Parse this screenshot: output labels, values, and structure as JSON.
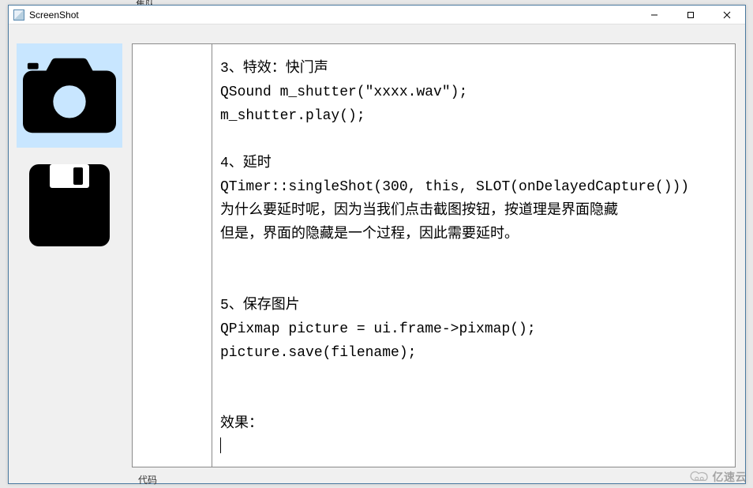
{
  "window": {
    "title": "ScreenShot"
  },
  "sidebar": {
    "camera_label": "capture-button",
    "save_label": "save-button"
  },
  "content": {
    "lines": [
      "3、特效：快门声",
      "QSound m_shutter(\"xxxx.wav\");",
      "m_shutter.play();",
      "",
      "4、延时",
      "QTimer::singleShot(300, this, SLOT(onDelayedCapture()))",
      "为什么要延时呢，因为当我们点击截图按钮，按道理是界面隐藏",
      "但是，界面的隐藏是一个过程，因此需要延时。",
      "",
      "",
      "5、保存图片",
      "QPixmap picture = ui.frame->pixmap();",
      "picture.save(filename);",
      "",
      "",
      "效果："
    ]
  },
  "background": {
    "top_fragment": "集队。",
    "bottom_fragment": "代码"
  },
  "watermark": {
    "text": "亿速云"
  }
}
